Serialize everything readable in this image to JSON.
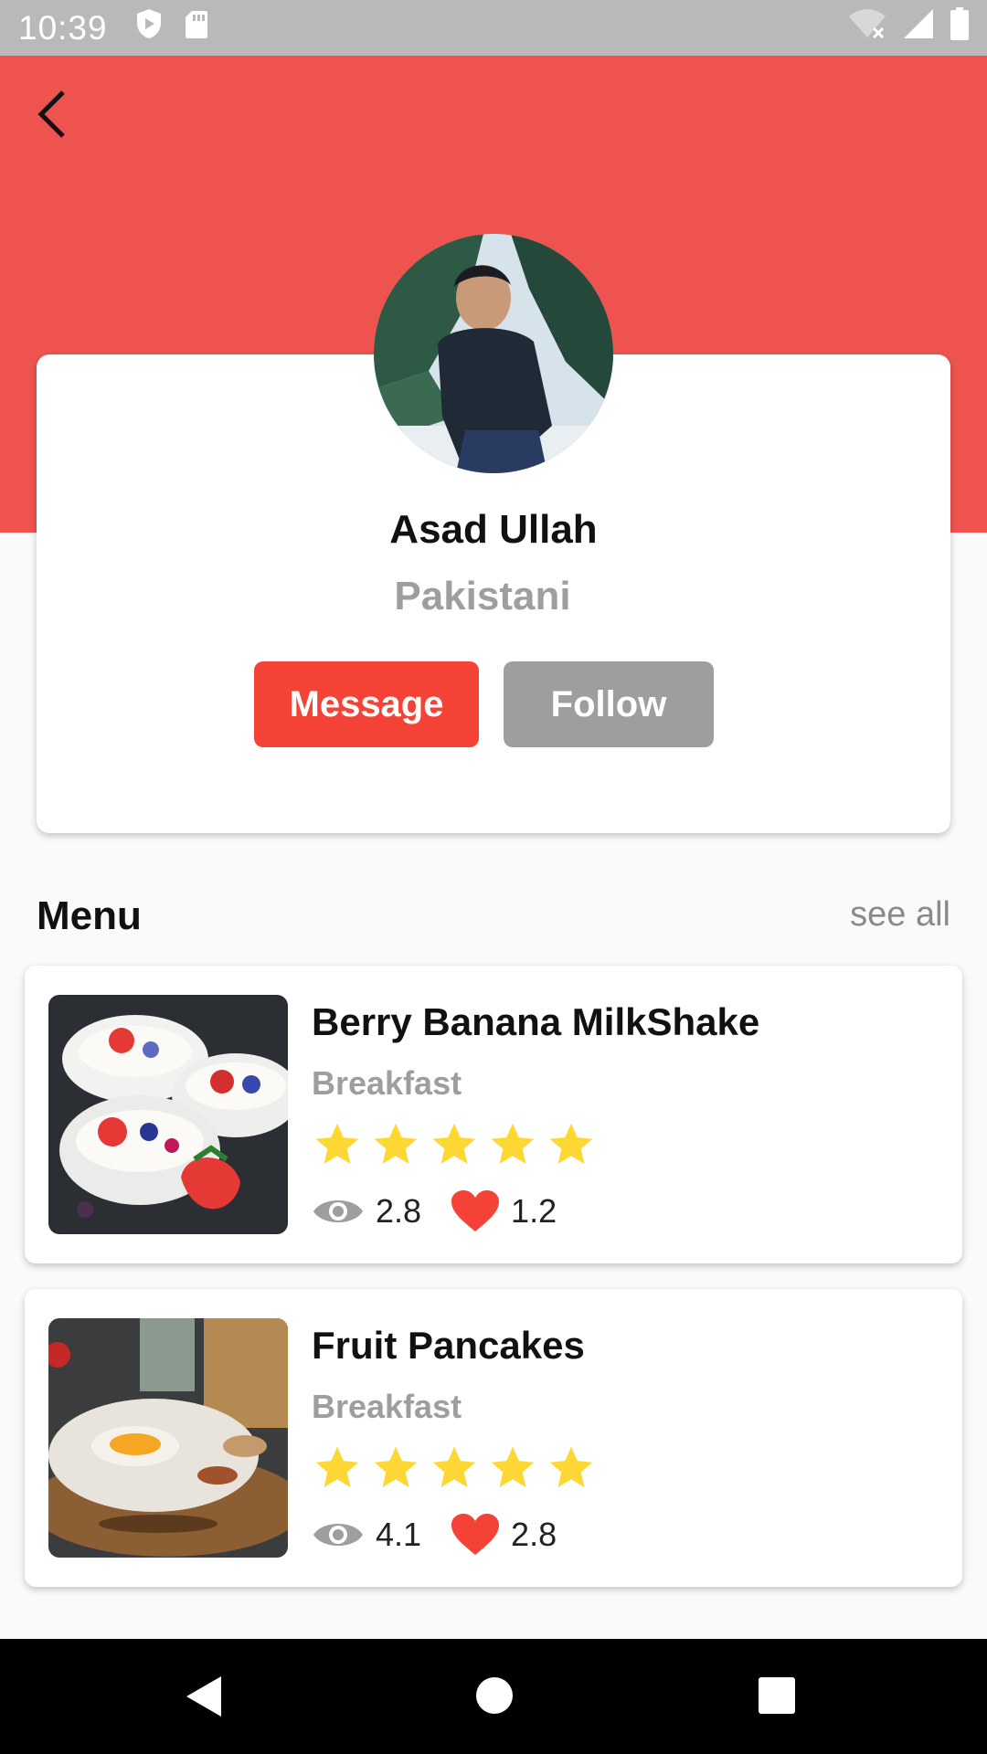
{
  "status_bar": {
    "time": "10:39",
    "icons": [
      "shield-icon",
      "sd-card-icon",
      "wifi-off-icon",
      "signal-icon",
      "battery-icon"
    ]
  },
  "colors": {
    "header": "#ef5350",
    "primary_button": "#f44336",
    "secondary_button": "#9e9e9e",
    "star": "#fdd835",
    "heart": "#f44336"
  },
  "header": {
    "back_icon": "back-arrow-icon"
  },
  "profile": {
    "name": "Asad Ullah",
    "country": "Pakistani",
    "message_label": "Message",
    "follow_label": "Follow"
  },
  "menu": {
    "title": "Menu",
    "see_all": "see all",
    "items": [
      {
        "title": "Berry Banana MilkShake",
        "category": "Breakfast",
        "rating": 5,
        "views": "2.8",
        "likes": "1.2"
      },
      {
        "title": "Fruit Pancakes",
        "category": "Breakfast",
        "rating": 5,
        "views": "4.1",
        "likes": "2.8"
      }
    ]
  },
  "nav": {
    "icons": [
      "back-triangle-icon",
      "home-circle-icon",
      "recents-square-icon"
    ]
  }
}
